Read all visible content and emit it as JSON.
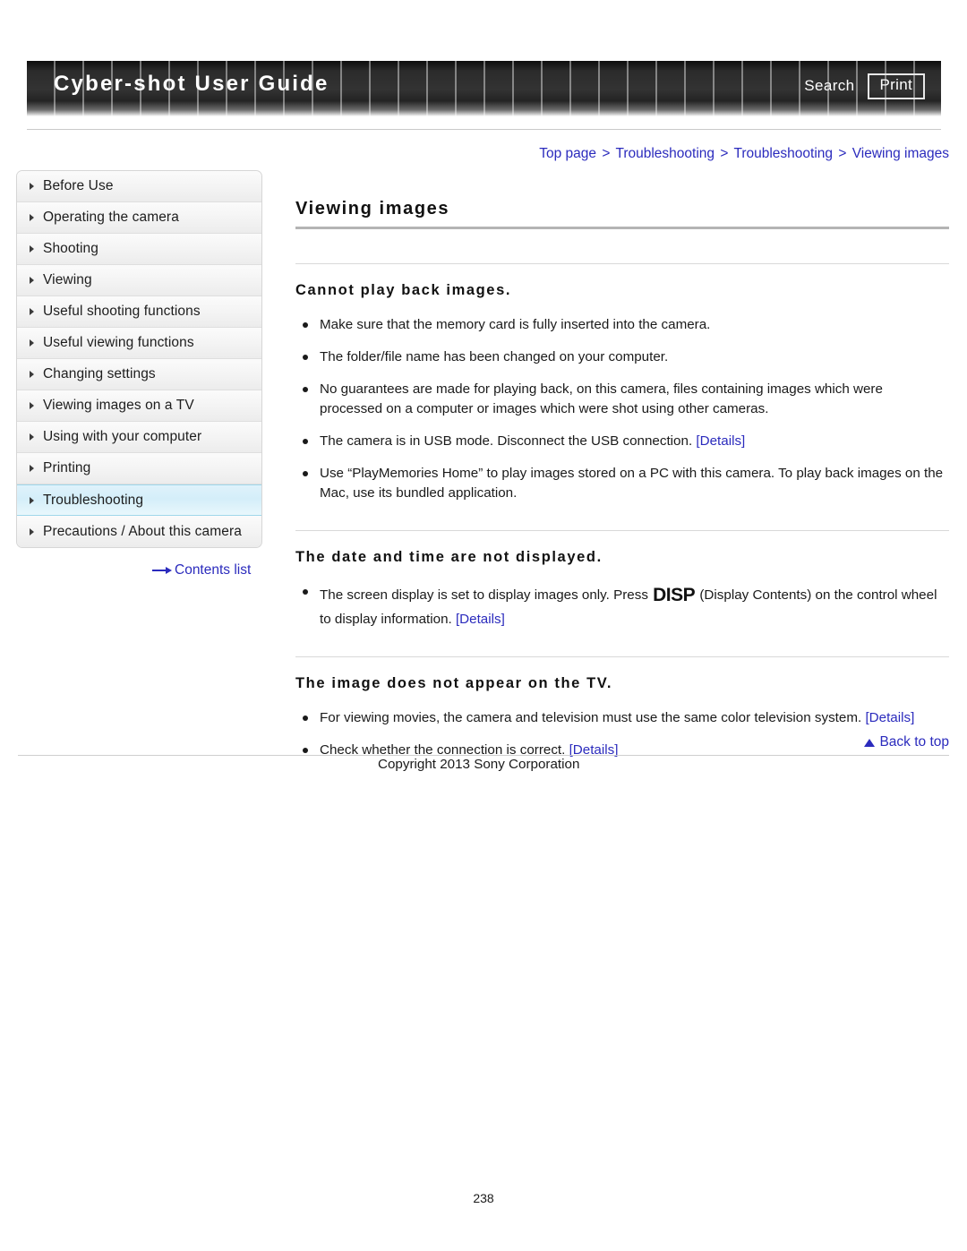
{
  "header": {
    "title": "Cyber-shot User Guide",
    "search_label": "Search",
    "print_label": "Print"
  },
  "breadcrumb": {
    "items": [
      "Top page",
      "Troubleshooting",
      "Troubleshooting",
      "Viewing images"
    ],
    "separator": ">"
  },
  "sidebar": {
    "items": [
      {
        "label": "Before Use",
        "selected": false
      },
      {
        "label": "Operating the camera",
        "selected": false
      },
      {
        "label": "Shooting",
        "selected": false
      },
      {
        "label": "Viewing",
        "selected": false
      },
      {
        "label": "Useful shooting functions",
        "selected": false
      },
      {
        "label": "Useful viewing functions",
        "selected": false
      },
      {
        "label": "Changing settings",
        "selected": false
      },
      {
        "label": "Viewing images on a TV",
        "selected": false
      },
      {
        "label": "Using with your computer",
        "selected": false
      },
      {
        "label": "Printing",
        "selected": false
      },
      {
        "label": "Troubleshooting",
        "selected": true
      },
      {
        "label": "Precautions / About this camera",
        "selected": false
      }
    ],
    "contents_list_label": "Contents list",
    "selected_highlight_color": "#d4eef9"
  },
  "main": {
    "page_title": "Viewing images",
    "sections": [
      {
        "heading": "Cannot play back images.",
        "bullets": [
          {
            "text": "Make sure that the memory card is fully inserted into the camera."
          },
          {
            "text": "The folder/file name has been changed on your computer."
          },
          {
            "text": "No guarantees are made for playing back, on this camera, files containing images which were processed on a computer or images which were shot using other cameras."
          },
          {
            "text": "The camera is in USB mode. Disconnect the USB connection. ",
            "link": "[Details]"
          },
          {
            "text": "Use “PlayMemories Home” to play images stored on a PC with this camera. To play back images on the Mac, use its bundled application."
          }
        ]
      },
      {
        "heading": "The date and time are not displayed.",
        "bullets": [
          {
            "text_before": "The screen display is set to display images only. Press ",
            "glyph": "DISP",
            "text_after": " (Display Contents) on the control wheel to display information. ",
            "link": "[Details]"
          }
        ]
      },
      {
        "heading": "The image does not appear on the TV.",
        "bullets": [
          {
            "text": "For viewing movies, the camera and television must use the same color television system. ",
            "link": "[Details]"
          },
          {
            "text": "Check whether the connection is correct. ",
            "link": "[Details]"
          }
        ]
      }
    ]
  },
  "footer": {
    "back_to_top_label": "Back to top",
    "copyright": "Copyright 2013 Sony Corporation",
    "page_number": "238"
  }
}
